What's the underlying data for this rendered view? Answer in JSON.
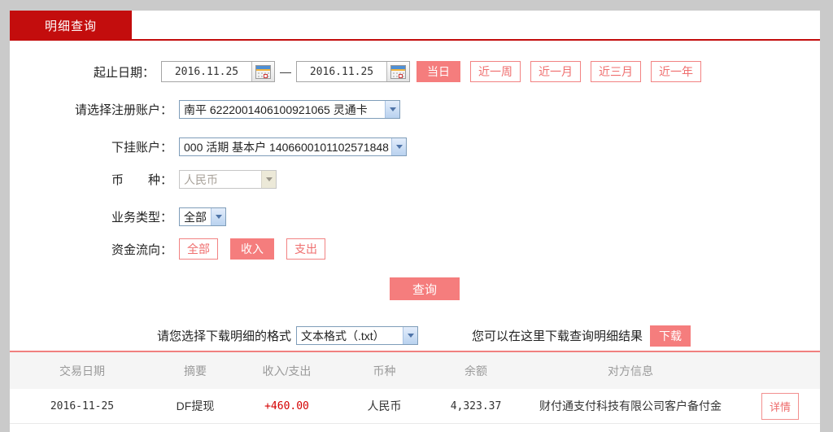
{
  "colors": {
    "brand_red": "#c30d0d",
    "salmon_fill": "#f57d7d",
    "pink_border": "#f28383",
    "amount_red": "#d40000",
    "page_bg": "#cacaca",
    "table_header_bg": "#f5f5f5"
  },
  "tab": {
    "label": "明细查询"
  },
  "form": {
    "date_row": {
      "label": "起止日期：",
      "start_value": "2016.11.25",
      "end_value": "2016.11.25",
      "separator": "—",
      "quick_buttons": [
        {
          "label": "当日",
          "active": true
        },
        {
          "label": "近一周",
          "active": false
        },
        {
          "label": "近一月",
          "active": false
        },
        {
          "label": "近三月",
          "active": false
        },
        {
          "label": "近一年",
          "active": false
        }
      ]
    },
    "register_account": {
      "label": "请选择注册账户：",
      "value": "南平 6222001406100921065 灵通卡"
    },
    "sub_account": {
      "label": "下挂账户：",
      "value": "000 活期 基本户 1406600101102571848"
    },
    "currency": {
      "label": "币　　种：",
      "value": "人民币",
      "disabled": true
    },
    "business_type": {
      "label": "业务类型：",
      "value": "全部"
    },
    "fund_flow": {
      "label": "资金流向：",
      "options": [
        {
          "label": "全部",
          "active": false
        },
        {
          "label": "收入",
          "active": true
        },
        {
          "label": "支出",
          "active": false
        }
      ]
    },
    "query_button": "查询"
  },
  "download": {
    "format_label": "请您选择下载明细的格式",
    "format_value": "文本格式（.txt）",
    "hint": "您可以在这里下载查询明细结果",
    "button": "下载"
  },
  "table": {
    "headers": [
      "交易日期",
      "摘要",
      "收入/支出",
      "币种",
      "余额",
      "对方信息"
    ],
    "rows": [
      {
        "date": "2016-11-25",
        "summary": "DF提现",
        "amount": "+460.00",
        "currency": "人民币",
        "balance": "4,323.37",
        "counterparty": "财付通支付科技有限公司客户备付金",
        "action": "详情"
      }
    ]
  },
  "icons": {
    "calendar": "calendar-icon",
    "select_arrow": "chevron-down-icon"
  }
}
